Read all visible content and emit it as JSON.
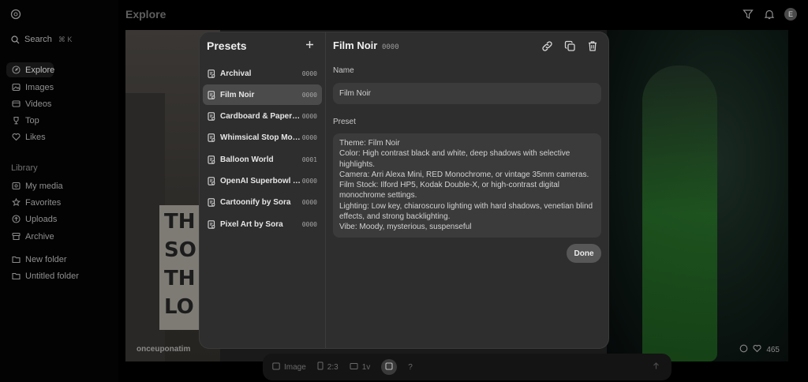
{
  "sidebar": {
    "search_label": "Search",
    "search_shortcut": "⌘ K",
    "nav": [
      {
        "label": "Explore",
        "icon": "compass-icon"
      },
      {
        "label": "Images",
        "icon": "image-icon"
      },
      {
        "label": "Videos",
        "icon": "video-icon"
      },
      {
        "label": "Top",
        "icon": "trophy-icon"
      },
      {
        "label": "Likes",
        "icon": "heart-icon"
      }
    ],
    "library_heading": "Library",
    "library": [
      {
        "label": "My media",
        "icon": "media-icon"
      },
      {
        "label": "Favorites",
        "icon": "star-icon"
      },
      {
        "label": "Uploads",
        "icon": "upload-icon"
      },
      {
        "label": "Archive",
        "icon": "archive-icon"
      }
    ],
    "folders": [
      {
        "label": "New folder",
        "icon": "folder-plus-icon"
      },
      {
        "label": "Untitled folder",
        "icon": "folder-icon"
      }
    ]
  },
  "header": {
    "title": "Explore",
    "avatar_initial": "E"
  },
  "gallery": {
    "credit": "onceuponatim",
    "likes": "465",
    "sign_text": [
      "TH",
      "SO",
      "TH",
      "LO"
    ]
  },
  "composer": {
    "type_label": "Image",
    "ratio_label": "2:3",
    "variants_label": "1v",
    "help": "?"
  },
  "modal": {
    "presets_title": "Presets",
    "presets": [
      {
        "name": "Archival",
        "code": "0000",
        "selected": false
      },
      {
        "name": "Film Noir",
        "code": "0000",
        "selected": true
      },
      {
        "name": "Cardboard & Papercraft",
        "code": "0000",
        "selected": false
      },
      {
        "name": "Whimsical Stop Motion",
        "code": "0000",
        "selected": false
      },
      {
        "name": "Balloon World",
        "code": "0001",
        "selected": false
      },
      {
        "name": "OpenAI Superbowl Ad",
        "code": "0000",
        "selected": false
      },
      {
        "name": "Cartoonify by Sora",
        "code": "0000",
        "selected": false
      },
      {
        "name": "Pixel Art by Sora",
        "code": "0000",
        "selected": false
      }
    ],
    "detail": {
      "title": "Film Noir",
      "code": "0000",
      "name_label": "Name",
      "name_value": "Film Noir",
      "preset_label": "Preset",
      "preset_lines": [
        "Theme: Film Noir",
        "Color: High contrast black and white, deep shadows with selective highlights.",
        "Camera: Arri Alexa Mini, RED Monochrome, or vintage 35mm cameras.",
        "Film Stock: Ilford HP5, Kodak Double-X, or high-contrast digital monochrome settings.",
        "Lighting: Low key, chiaroscuro lighting with hard shadows, venetian blind effects, and strong backlighting.",
        "Vibe: Moody, mysterious, suspenseful"
      ],
      "done_label": "Done"
    }
  }
}
